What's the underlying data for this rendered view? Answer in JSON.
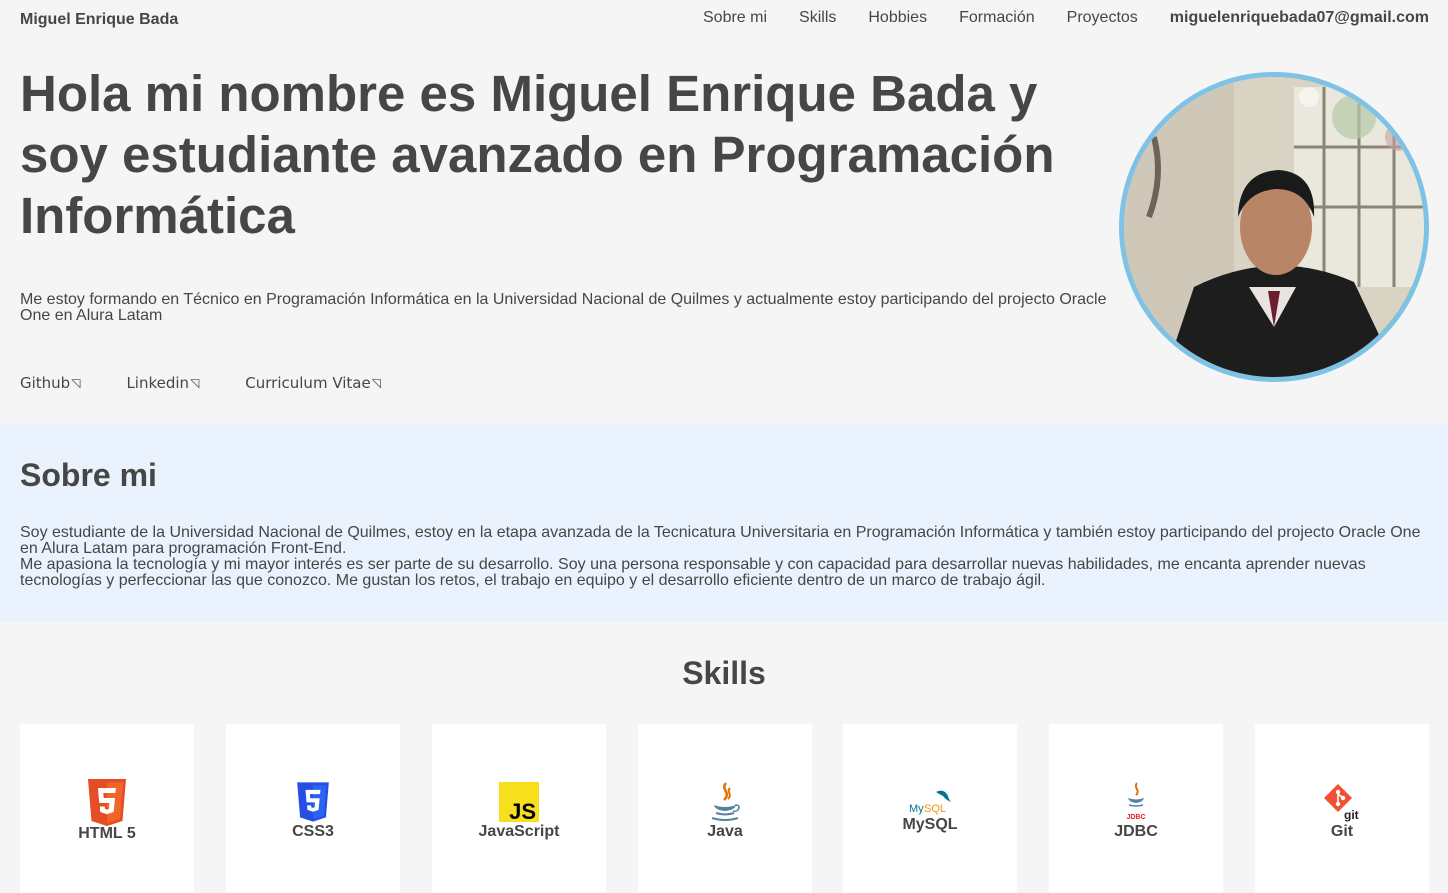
{
  "header": {
    "brand": "Miguel Enrique Bada",
    "nav": [
      "Sobre mi",
      "Skills",
      "Hobbies",
      "Formación",
      "Proyectos"
    ],
    "email": "miguelenriquebada07@gmail.com"
  },
  "hero": {
    "title": "Hola mi nombre es Miguel Enrique Bada y soy estudiante avanzado en Programación Informática",
    "text": "Me estoy formando en Técnico en Programación Informática en la Universidad Nacional de Quilmes y actualmente estoy participando del projecto Oracle One en Alura Latam",
    "links": [
      "Github",
      "Linkedin",
      "Curriculum Vitae"
    ],
    "link_arrow": "◹"
  },
  "about": {
    "title": "Sobre mi",
    "p1": "Soy estudiante de la Universidad Nacional de Quilmes, estoy en la etapa avanzada de la Tecnicatura Universitaria en Programación Informática y también estoy participando del projecto Oracle One en Alura Latam para programación Front-End.",
    "p2": "Me apasiona la tecnología y mi mayor interés es ser parte de su desarrollo. Soy una persona responsable y con capacidad para desarrollar nuevas habilidades, me encanta aprender nuevas tecnologías y perfeccionar las que conozco. Me gustan los retos, el trabajo en equipo y el desarrollo eficiente dentro de un marco de trabajo ágil."
  },
  "skills": {
    "title": "Skills",
    "items": [
      {
        "label": "HTML 5",
        "icon": "html5-icon",
        "color": "#e44d26"
      },
      {
        "label": "CSS3",
        "icon": "css3-icon",
        "color": "#264de4"
      },
      {
        "label": "JavaScript",
        "icon": "javascript-icon",
        "color": "#f7df1e"
      },
      {
        "label": "Java",
        "icon": "java-icon",
        "color": "#e76f00"
      },
      {
        "label": "MySQL",
        "icon": "mysql-icon",
        "color": "#00758f"
      },
      {
        "label": "JDBC",
        "icon": "jdbc-icon",
        "color": "#e76f00"
      },
      {
        "label": "Git",
        "icon": "git-icon",
        "color": "#f05033"
      }
    ]
  },
  "colors": {
    "text": "#464646",
    "background": "#f5f5f5",
    "about_background": "#eaf2fd",
    "avatar_border": "#7ec3e6"
  }
}
